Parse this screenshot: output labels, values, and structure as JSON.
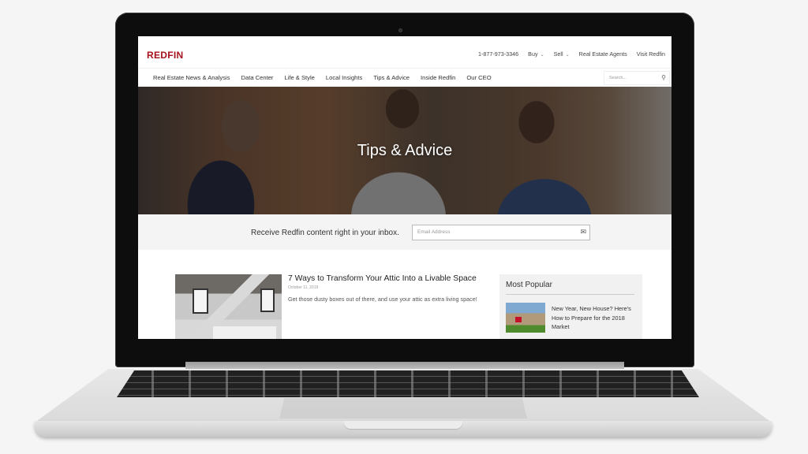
{
  "site": {
    "logo": "REDFIN",
    "brand_color": "#a5121c"
  },
  "utility_nav": {
    "phone": "1-877-973-3346",
    "buy": "Buy",
    "sell": "Sell",
    "agents": "Real Estate Agents",
    "visit": "Visit Redfin",
    "caret": "⌄"
  },
  "main_nav": {
    "items": [
      {
        "label": "Real Estate News & Analysis"
      },
      {
        "label": "Data Center"
      },
      {
        "label": "Life & Style"
      },
      {
        "label": "Local Insights"
      },
      {
        "label": "Tips & Advice"
      },
      {
        "label": "Inside Redfin"
      },
      {
        "label": "Our CEO"
      }
    ],
    "search_placeholder": "Search...",
    "search_icon": "⚲"
  },
  "hero": {
    "title": "Tips & Advice"
  },
  "subscribe": {
    "label": "Receive Redfin content right in your inbox.",
    "email_placeholder": "Email Address",
    "email_icon": "✉"
  },
  "article": {
    "title": "7 Ways to Transform Your Attic Into a Livable Space",
    "date": "October 11, 2019",
    "excerpt": "Get those dusty boxes out of there, and use your attic as extra living space!"
  },
  "sidebar": {
    "heading": "Most Popular",
    "items": [
      {
        "title": "New Year, New House? Here's How to Prepare for the 2018 Market"
      }
    ]
  }
}
